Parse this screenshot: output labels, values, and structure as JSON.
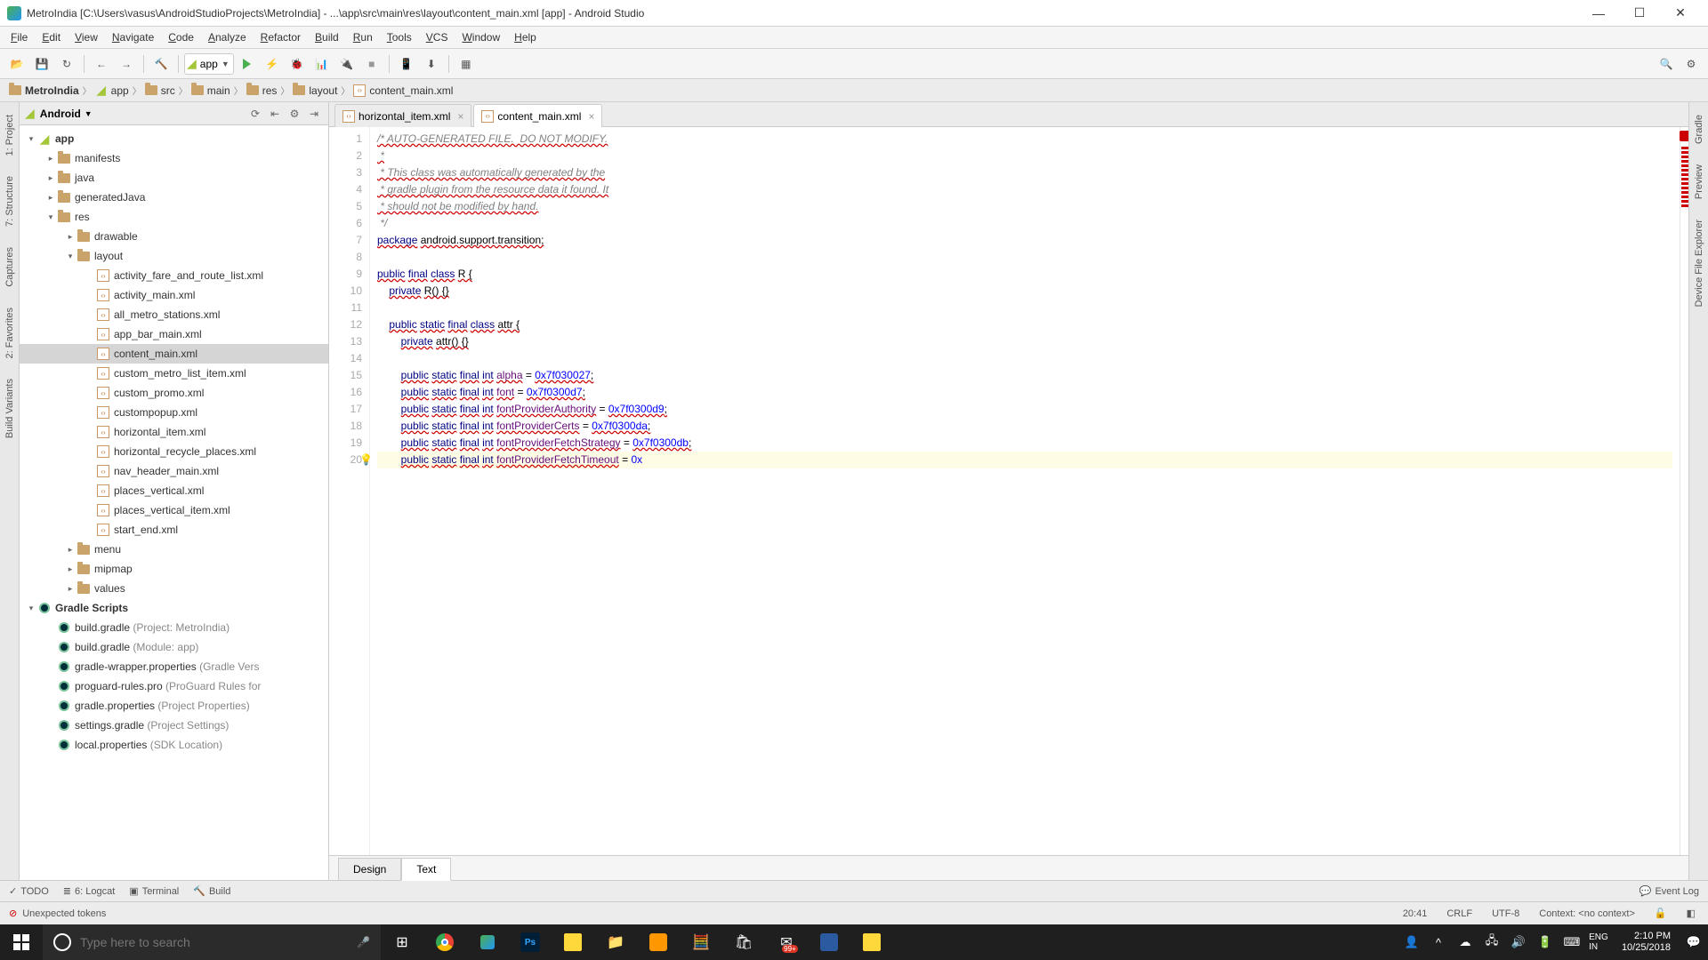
{
  "titlebar": {
    "title": "MetroIndia [C:\\Users\\vasus\\AndroidStudioProjects\\MetroIndia] - ...\\app\\src\\main\\res\\layout\\content_main.xml [app] - Android Studio"
  },
  "menus": [
    "File",
    "Edit",
    "View",
    "Navigate",
    "Code",
    "Analyze",
    "Refactor",
    "Build",
    "Run",
    "Tools",
    "VCS",
    "Window",
    "Help"
  ],
  "run_config": "app",
  "breadcrumb": [
    {
      "label": "MetroIndia",
      "bold": true,
      "icon": "folder"
    },
    {
      "label": "app",
      "icon": "module"
    },
    {
      "label": "src",
      "icon": "folder"
    },
    {
      "label": "main",
      "icon": "folder"
    },
    {
      "label": "res",
      "icon": "folder"
    },
    {
      "label": "layout",
      "icon": "folder"
    },
    {
      "label": "content_main.xml",
      "icon": "xml"
    }
  ],
  "left_rails": [
    "1: Project",
    "7: Structure",
    "Captures"
  ],
  "left_rails_bottom": [
    "2: Favorites",
    "Build Variants"
  ],
  "right_rails": [
    "Gradle",
    "Preview",
    "Device File Explorer"
  ],
  "project_header": {
    "mode": "Android"
  },
  "project_tree": [
    {
      "indent": 0,
      "toggle": "down",
      "icon": "module",
      "label": "app",
      "bold": true
    },
    {
      "indent": 1,
      "toggle": "right",
      "icon": "folder",
      "label": "manifests"
    },
    {
      "indent": 1,
      "toggle": "right",
      "icon": "folder",
      "label": "java"
    },
    {
      "indent": 1,
      "toggle": "right",
      "icon": "folder",
      "label": "generatedJava"
    },
    {
      "indent": 1,
      "toggle": "down",
      "icon": "folder",
      "label": "res"
    },
    {
      "indent": 2,
      "toggle": "right",
      "icon": "folder",
      "label": "drawable"
    },
    {
      "indent": 2,
      "toggle": "down",
      "icon": "folder",
      "label": "layout"
    },
    {
      "indent": 3,
      "toggle": "",
      "icon": "xml",
      "label": "activity_fare_and_route_list.xml"
    },
    {
      "indent": 3,
      "toggle": "",
      "icon": "xml",
      "label": "activity_main.xml"
    },
    {
      "indent": 3,
      "toggle": "",
      "icon": "xml",
      "label": "all_metro_stations.xml"
    },
    {
      "indent": 3,
      "toggle": "",
      "icon": "xml",
      "label": "app_bar_main.xml"
    },
    {
      "indent": 3,
      "toggle": "",
      "icon": "xml",
      "label": "content_main.xml",
      "selected": true
    },
    {
      "indent": 3,
      "toggle": "",
      "icon": "xml",
      "label": "custom_metro_list_item.xml"
    },
    {
      "indent": 3,
      "toggle": "",
      "icon": "xml",
      "label": "custom_promo.xml"
    },
    {
      "indent": 3,
      "toggle": "",
      "icon": "xml",
      "label": "custompopup.xml"
    },
    {
      "indent": 3,
      "toggle": "",
      "icon": "xml",
      "label": "horizontal_item.xml"
    },
    {
      "indent": 3,
      "toggle": "",
      "icon": "xml",
      "label": "horizontal_recycle_places.xml"
    },
    {
      "indent": 3,
      "toggle": "",
      "icon": "xml",
      "label": "nav_header_main.xml"
    },
    {
      "indent": 3,
      "toggle": "",
      "icon": "xml",
      "label": "places_vertical.xml"
    },
    {
      "indent": 3,
      "toggle": "",
      "icon": "xml",
      "label": "places_vertical_item.xml"
    },
    {
      "indent": 3,
      "toggle": "",
      "icon": "xml",
      "label": "start_end.xml"
    },
    {
      "indent": 2,
      "toggle": "right",
      "icon": "folder",
      "label": "menu"
    },
    {
      "indent": 2,
      "toggle": "right",
      "icon": "folder",
      "label": "mipmap"
    },
    {
      "indent": 2,
      "toggle": "right",
      "icon": "folder",
      "label": "values"
    },
    {
      "indent": 0,
      "toggle": "down",
      "icon": "gradle",
      "label": "Gradle Scripts",
      "bold": true
    },
    {
      "indent": 1,
      "toggle": "",
      "icon": "gradle",
      "label": "build.gradle",
      "hint": " (Project: MetroIndia)"
    },
    {
      "indent": 1,
      "toggle": "",
      "icon": "gradle",
      "label": "build.gradle",
      "hint": " (Module: app)"
    },
    {
      "indent": 1,
      "toggle": "",
      "icon": "gradle",
      "label": "gradle-wrapper.properties",
      "hint": " (Gradle Vers"
    },
    {
      "indent": 1,
      "toggle": "",
      "icon": "gradle",
      "label": "proguard-rules.pro",
      "hint": " (ProGuard Rules for"
    },
    {
      "indent": 1,
      "toggle": "",
      "icon": "gradle",
      "label": "gradle.properties",
      "hint": " (Project Properties)"
    },
    {
      "indent": 1,
      "toggle": "",
      "icon": "gradle",
      "label": "settings.gradle",
      "hint": " (Project Settings)"
    },
    {
      "indent": 1,
      "toggle": "",
      "icon": "gradle",
      "label": "local.properties",
      "hint": " (SDK Location)"
    }
  ],
  "editor_tabs": [
    {
      "label": "horizontal_item.xml",
      "active": false
    },
    {
      "label": "content_main.xml",
      "active": true
    }
  ],
  "code_lines": [
    {
      "n": 1,
      "html": "<span class='cm underline'>/* AUTO-GENERATED FILE.  DO NOT MODIFY.</span>"
    },
    {
      "n": 2,
      "html": "<span class='cm underline'> *</span>"
    },
    {
      "n": 3,
      "html": "<span class='cm underline'> * This class was automatically generated by the</span>"
    },
    {
      "n": 4,
      "html": "<span class='cm underline'> * gradle plugin from the resource data it found. It</span>"
    },
    {
      "n": 5,
      "html": "<span class='cm underline'> * should not be modified by hand.</span>"
    },
    {
      "n": 6,
      "html": "<span class='cm'> */</span>"
    },
    {
      "n": 7,
      "html": "<span class='kw underline'>package</span> <span class='underline'>android.support.transition;</span>"
    },
    {
      "n": 8,
      "html": ""
    },
    {
      "n": 9,
      "html": "<span class='kw underline'>public</span> <span class='kw underline'>final</span> <span class='kw underline'>class</span> <span class='underline'>R {</span>"
    },
    {
      "n": 10,
      "html": "    <span class='kw underline'>private</span> <span class='underline'>R() {}</span>"
    },
    {
      "n": 11,
      "html": ""
    },
    {
      "n": 12,
      "html": "    <span class='kw underline'>public</span> <span class='kw underline'>static</span> <span class='kw underline'>final</span> <span class='kw underline'>class</span> <span class='underline'>attr {</span>"
    },
    {
      "n": 13,
      "html": "        <span class='kw underline'>private</span> <span class='underline'>attr() {}</span>"
    },
    {
      "n": 14,
      "html": ""
    },
    {
      "n": 15,
      "html": "        <span class='kw underline'>public</span> <span class='kw underline'>static</span> <span class='kw underline'>final</span> <span class='kw underline'>int</span> <span class='id underline'>alpha</span> = <span class='num underline'>0x7f030027</span><span class='underline'>;</span>"
    },
    {
      "n": 16,
      "html": "        <span class='kw underline'>public</span> <span class='kw underline'>static</span> <span class='kw underline'>final</span> <span class='kw underline'>int</span> <span class='id underline'>font</span> = <span class='num underline'>0x7f0300d7</span><span class='underline'>;</span>"
    },
    {
      "n": 17,
      "html": "        <span class='kw underline'>public</span> <span class='kw underline'>static</span> <span class='kw underline'>final</span> <span class='kw underline'>int</span> <span class='id underline'>fontProviderAuthority</span> = <span class='num underline'>0x7f0300d9</span><span class='underline'>;</span>"
    },
    {
      "n": 18,
      "html": "        <span class='kw underline'>public</span> <span class='kw underline'>static</span> <span class='kw underline'>final</span> <span class='kw underline'>int</span> <span class='id underline'>fontProviderCerts</span> = <span class='num underline'>0x7f0300da</span><span class='underline'>;</span>"
    },
    {
      "n": 19,
      "html": "        <span class='kw underline'>public</span> <span class='kw underline'>static</span> <span class='kw underline'>final</span> <span class='kw underline'>int</span> <span class='id underline'>fontProviderFetchStrategy</span> = <span class='num underline'>0x7f0300db</span><span class='underline'>;</span>"
    },
    {
      "n": 20,
      "html": "        <span class='kw underline'>public</span> <span class='kw underline'>static</span> <span class='kw underline'>final</span> <span class='kw underline'>int</span> <span class='id underline'>fontProviderFetchTimeout</span> = <span class='num'>0x</span>",
      "highlight": true,
      "bulb": true
    }
  ],
  "footer_tabs": [
    "Design",
    "Text"
  ],
  "footer_active": "Text",
  "bottom_tools": [
    {
      "icon": "✓",
      "label": "TODO"
    },
    {
      "icon": "≣",
      "label": "6: Logcat"
    },
    {
      "icon": "▣",
      "label": "Terminal"
    },
    {
      "icon": "🔨",
      "label": "Build"
    }
  ],
  "event_log": "Event Log",
  "status": {
    "message": "Unexpected tokens",
    "pos": "20:41",
    "line_ending": "CRLF",
    "encoding": "UTF-8",
    "context": "Context: <no context>"
  },
  "taskbar": {
    "search_placeholder": "Type here to search",
    "clock": {
      "time": "2:10 PM",
      "date": "10/25/2018"
    }
  }
}
